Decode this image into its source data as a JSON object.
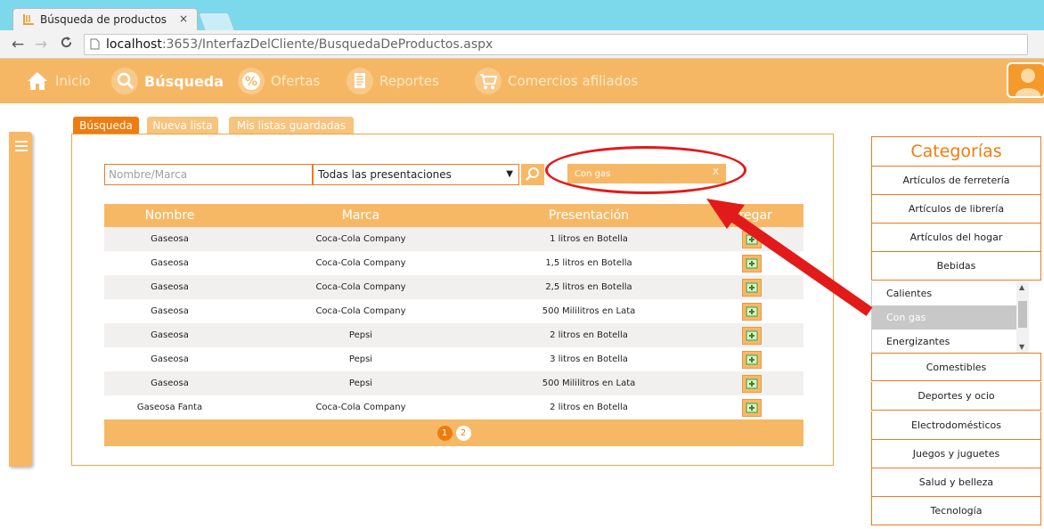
{
  "browser": {
    "tab_title": "Búsqueda de productos",
    "tab_close": "×",
    "url_host": "localhost",
    "url_rest": ":3653/InterfazDelCliente/BusquedaDeProductos.aspx"
  },
  "navbar": {
    "items": [
      {
        "label": "Inicio",
        "icon": "home-icon"
      },
      {
        "label": "Búsqueda",
        "icon": "search-icon",
        "active": true
      },
      {
        "label": "Ofertas",
        "icon": "percent-icon"
      },
      {
        "label": "Reportes",
        "icon": "document-icon"
      },
      {
        "label": "Comercios afiliados",
        "icon": "cart-icon"
      }
    ]
  },
  "tabs": [
    {
      "label": "Búsqueda",
      "active": true
    },
    {
      "label": "Nueva lista"
    },
    {
      "label": "Mis listas guardadas"
    }
  ],
  "search": {
    "placeholder": "Nombre/Marca",
    "presentation_selected": "Todas las presentaciones",
    "filter_chip": "Con gas",
    "filter_chip_remove": "X"
  },
  "table": {
    "headers": [
      "Nombre",
      "Marca",
      "Presentación",
      "Agregar"
    ],
    "rows": [
      {
        "nombre": "Gaseosa",
        "marca": "Coca-Cola Company",
        "presentacion": "1 litros en Botella"
      },
      {
        "nombre": "Gaseosa",
        "marca": "Coca-Cola Company",
        "presentacion": "1,5 litros en Botella"
      },
      {
        "nombre": "Gaseosa",
        "marca": "Coca-Cola Company",
        "presentacion": "2,5 litros en Botella"
      },
      {
        "nombre": "Gaseosa",
        "marca": "Coca-Cola Company",
        "presentacion": "500 Mililitros en Lata"
      },
      {
        "nombre": "Gaseosa",
        "marca": "Pepsi",
        "presentacion": "2 litros en Botella"
      },
      {
        "nombre": "Gaseosa",
        "marca": "Pepsi",
        "presentacion": "3 litros en Botella"
      },
      {
        "nombre": "Gaseosa",
        "marca": "Pepsi",
        "presentacion": "500 Mililitros en Lata"
      },
      {
        "nombre": "Gaseosa Fanta",
        "marca": "Coca-Cola Company",
        "presentacion": "2 litros en Botella"
      }
    ],
    "pages": [
      "1",
      "2"
    ],
    "current_page": "1"
  },
  "categories": {
    "title": "Categorías",
    "top": [
      "Artículos de ferretería",
      "Artículos de librería",
      "Artículos del hogar",
      "Bebidas"
    ],
    "sub": [
      {
        "label": "Calientes"
      },
      {
        "label": "Con gas",
        "selected": true
      },
      {
        "label": "Energizantes"
      }
    ],
    "bottom": [
      "Comestibles",
      "Deportes y ocio",
      "Electrodomésticos",
      "Juegos y juguetes",
      "Salud y belleza",
      "Tecnología"
    ]
  },
  "colors": {
    "accent": "#ef7c0f",
    "nav_bg": "#f6b765",
    "annotation": "#e21a1a"
  }
}
